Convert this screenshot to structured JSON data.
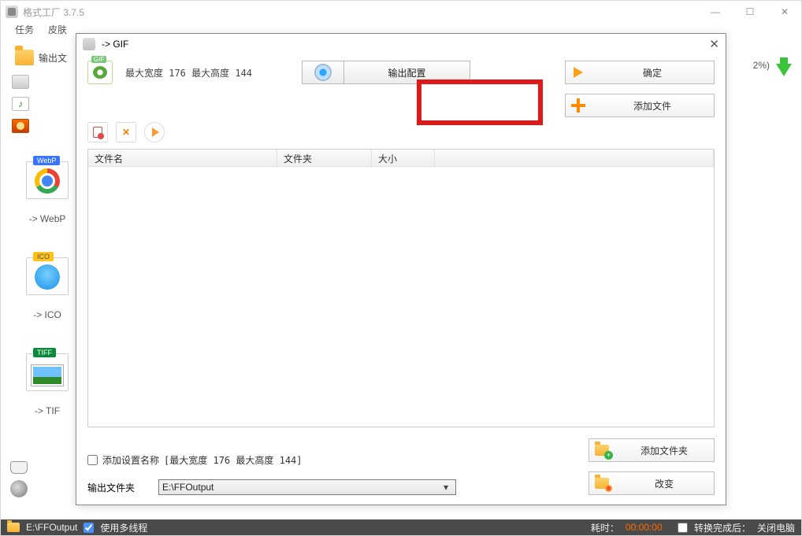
{
  "main": {
    "title": "格式工厂 3.7.5",
    "menu": {
      "task": "任务",
      "skin": "皮肤"
    },
    "output_label_trunc": "输出文",
    "pct": "2%)",
    "cards": {
      "webp": {
        "badge": "WebP",
        "caption": "-> WebP"
      },
      "ico": {
        "badge": "ICO",
        "caption": "-> ICO"
      },
      "tif": {
        "badge": "TIFF",
        "caption": "-> TIF"
      }
    }
  },
  "modal": {
    "title": "-> GIF",
    "gif_badge": "GIF",
    "spec": "最大宽度 176 最大高度 144",
    "output_config": "输出配置",
    "ok": "确定",
    "add_file": "添加文件",
    "headers": {
      "name": "文件名",
      "folder": "文件夹",
      "size": "大小"
    },
    "add_spec_label": "添加设置名称",
    "add_spec_value": "[最大宽度 176 最大高度 144]",
    "output_folder_label": "输出文件夹",
    "output_folder_value": "E:\\FFOutput",
    "add_folder": "添加文件夹",
    "change": "改变"
  },
  "status": {
    "path": "E:\\FFOutput",
    "multithread": "使用多线程",
    "elapsed_label": "耗时：",
    "elapsed_value": "00:00:00",
    "after_label": "转换完成后：",
    "after_value": "关闭电脑"
  }
}
